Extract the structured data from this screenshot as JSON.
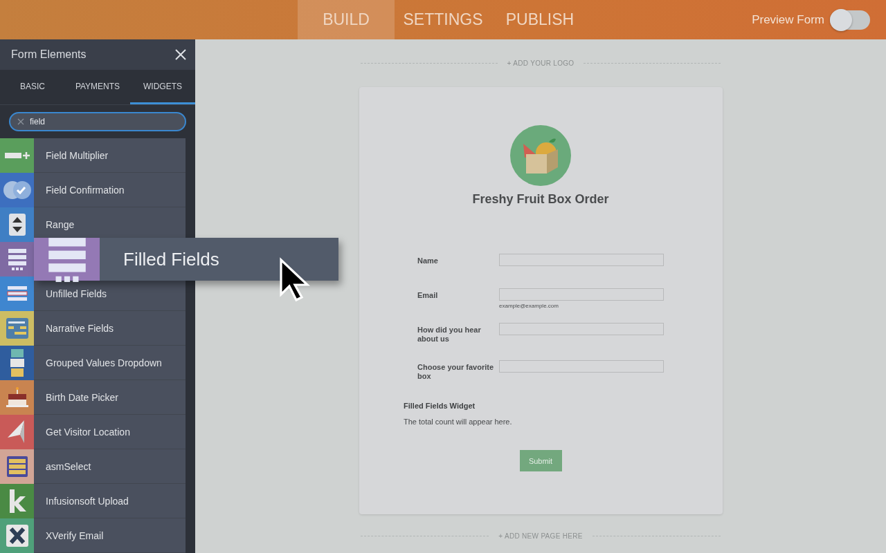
{
  "topbar": {
    "tabs": [
      {
        "label": "BUILD",
        "selected": true
      },
      {
        "label": "SETTINGS",
        "selected": false
      },
      {
        "label": "PUBLISH",
        "selected": false
      }
    ],
    "preview": {
      "label": "Preview Form",
      "on": false
    }
  },
  "sidebar": {
    "title": "Form Elements",
    "tabs": [
      {
        "label": "BASIC",
        "selected": false
      },
      {
        "label": "PAYMENTS",
        "selected": false
      },
      {
        "label": "WIDGETS",
        "selected": true
      }
    ],
    "search": {
      "value": "field"
    },
    "items": [
      {
        "label": "Field Multiplier",
        "kind": "multiplier",
        "color": "#5a9e5c"
      },
      {
        "label": "Field Confirmation",
        "kind": "confirm",
        "color": "#3d6fbf"
      },
      {
        "label": "Range",
        "kind": "range",
        "color": "#3f7fc4"
      },
      {
        "kind": "filled",
        "color": "#7f6aa3"
      },
      {
        "label": "Unfilled Fields",
        "kind": "unfilled",
        "color": "#3f86cf"
      },
      {
        "label": "Narrative Fields",
        "kind": "narrative",
        "color": "#cdbd63"
      },
      {
        "label": "Grouped Values Dropdown",
        "kind": "grouped",
        "color": "#2f5d9e"
      },
      {
        "label": "Birth Date Picker",
        "kind": "cake",
        "color": "#c98450"
      },
      {
        "label": "Get Visitor Location",
        "kind": "location",
        "color": "#c95a58"
      },
      {
        "label": "asmSelect",
        "kind": "asm",
        "color": "#d2a596"
      },
      {
        "label": "Infusionsoft Upload",
        "kind": "infusion",
        "color": "#4a8a44"
      },
      {
        "label": "XVerify Email",
        "kind": "xverify",
        "color": "#4fa07a"
      }
    ]
  },
  "dragged": {
    "label": "Filled Fields",
    "kind": "filled",
    "color": "#9479b5"
  },
  "canvas": {
    "add_logo": "+ ADD YOUR LOGO",
    "form": {
      "title": "Freshy Fruit Box Order",
      "fields": [
        {
          "label": "Name"
        },
        {
          "label": "Email",
          "sublabel": "example@example.com"
        },
        {
          "label": "How did you hear about us"
        },
        {
          "label": "Choose your favorite box"
        }
      ],
      "widget": {
        "title": "Filled Fields Widget",
        "text": "The total count will appear here."
      },
      "submit": "Submit"
    },
    "add_page": "+ ADD NEW PAGE HERE"
  }
}
